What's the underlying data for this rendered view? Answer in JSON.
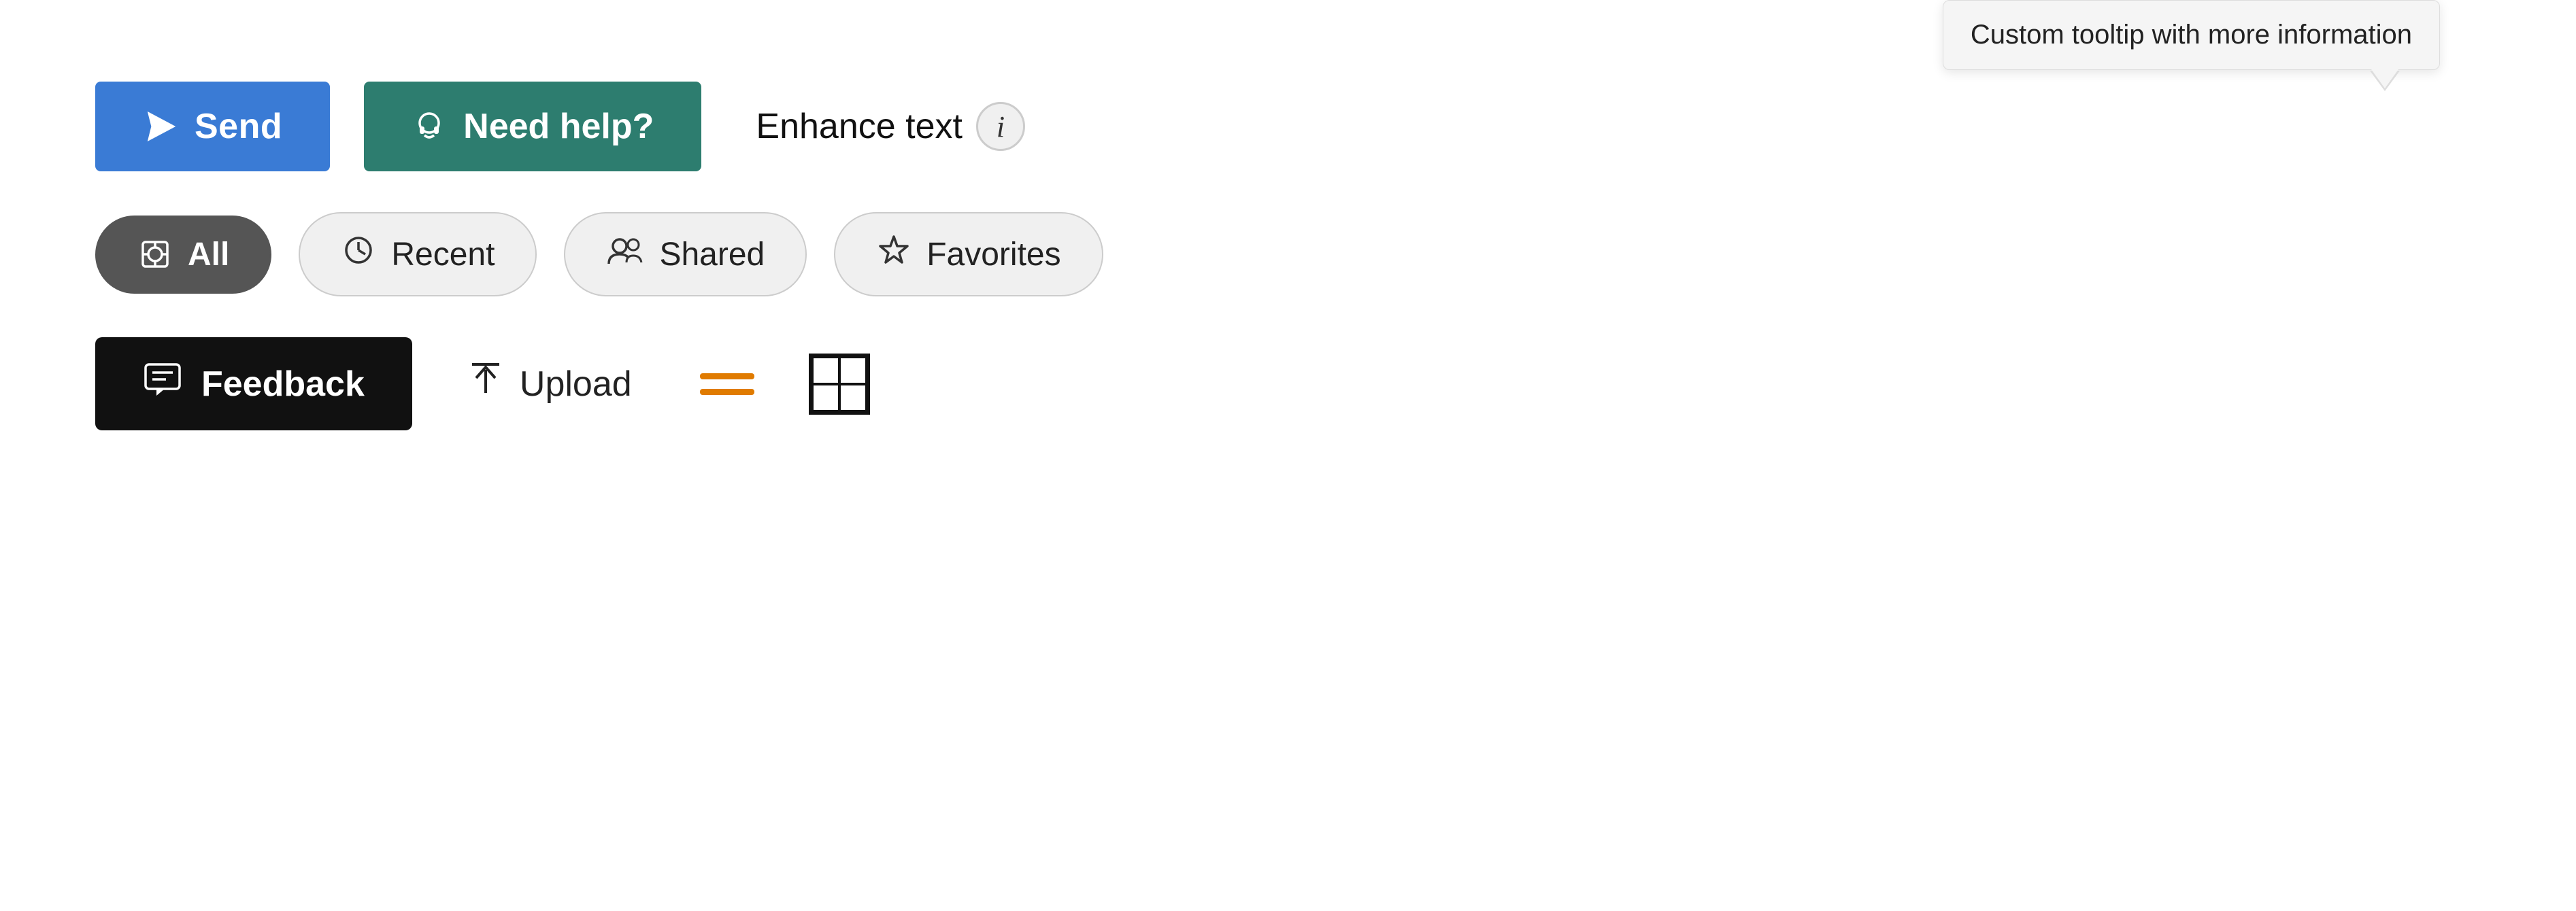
{
  "tooltip": {
    "text": "Custom tooltip with more information"
  },
  "row1": {
    "send_label": "Send",
    "need_help_label": "Need help?",
    "enhance_text_label": "Enhance text",
    "info_icon": "i"
  },
  "row2": {
    "filters": [
      {
        "id": "all",
        "label": "All",
        "icon": "⊙",
        "active": true
      },
      {
        "id": "recent",
        "label": "Recent",
        "icon": "⊙",
        "active": false
      },
      {
        "id": "shared",
        "label": "Shared",
        "icon": "⊙",
        "active": false
      },
      {
        "id": "favorites",
        "label": "Favorites",
        "icon": "⊙",
        "active": false
      }
    ]
  },
  "row3": {
    "feedback_label": "Feedback",
    "upload_label": "Upload"
  },
  "colors": {
    "send_bg": "#3a7bd5",
    "need_help_bg": "#2d7d6f",
    "feedback_bg": "#111111",
    "active_filter_bg": "#555555",
    "orange": "#e07b00"
  }
}
